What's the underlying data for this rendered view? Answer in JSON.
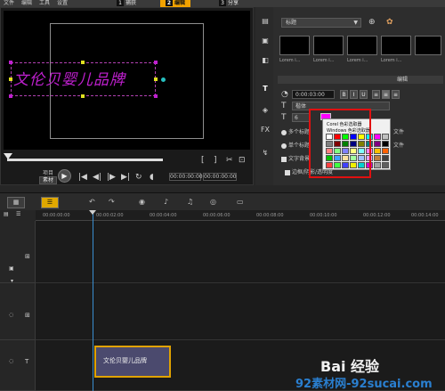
{
  "menu": [
    "文件",
    "编辑",
    "工具",
    "设置"
  ],
  "steps": [
    {
      "num": "1",
      "label": "捕获",
      "active": false
    },
    {
      "num": "2",
      "label": "编辑",
      "active": true
    },
    {
      "num": "3",
      "label": "分享",
      "active": false
    }
  ],
  "preview": {
    "title_text": "文伦贝婴儿品牌",
    "project_label": "项目",
    "material_label": "素材",
    "timecode": "00:00:00:00"
  },
  "library": {
    "category": "标题",
    "thumbnail_label": "Lorem i..."
  },
  "options": {
    "edit_tab": "编辑",
    "duration": "0:00:03:00",
    "bold": "B",
    "italic": "I",
    "underline": "U",
    "font": "楷体",
    "size": "6",
    "multi_title": "多个标题",
    "single_title": "单个标题",
    "text_bg": "文字背景",
    "border": "边框/阴影/透明度",
    "file1": "文件",
    "file2": "文件"
  },
  "color_popup": {
    "corel_picker": "Corel 色彩选取器",
    "windows_picker": "Windows 色彩选取器",
    "swatches": [
      "#ffffff",
      "#ff0000",
      "#00ff00",
      "#0000ff",
      "#ffff00",
      "#00ffff",
      "#ff00ff",
      "#c0c0c0",
      "#808080",
      "#800000",
      "#008000",
      "#000080",
      "#808000",
      "#008080",
      "#800080",
      "#000000",
      "#ff8080",
      "#80ff80",
      "#8080ff",
      "#ffff80",
      "#80ffff",
      "#ff80ff",
      "#ffc000",
      "#ff6000",
      "#00c000",
      "#40a0ff",
      "#ffe0a0",
      "#a0ffa0",
      "#a0c0ff",
      "#e0a0ff",
      "#c08040",
      "#404040",
      "#ff4040",
      "#40ff40",
      "#4040ff",
      "#f0f000",
      "#00d0d0",
      "#d000d0",
      "#a0a0a0",
      "#606060"
    ]
  },
  "timeline": {
    "ticks": [
      "00:00:00:00",
      "00:00:02:00",
      "00:00:04:00",
      "00:00:06:00",
      "00:00:08:00",
      "00:00:10:00",
      "00:00:12:00",
      "00:00:14:00"
    ],
    "clip_label": "文伦贝婴儿品牌"
  },
  "watermarks": {
    "baidu": "Bai 经验",
    "site": "92素材网-92sucai.com"
  },
  "colors": {
    "accent": "#f2a200",
    "title_magenta": "#c020d0",
    "highlight_red": "#e01010",
    "playhead_blue": "#3a8ed0"
  }
}
